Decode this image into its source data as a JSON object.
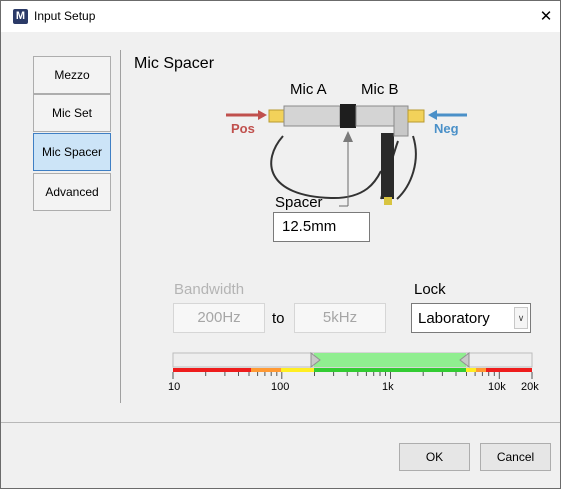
{
  "window": {
    "app_icon_letter": "M",
    "title": "Input Setup",
    "close_glyph": "✕"
  },
  "nav": {
    "items": [
      {
        "label": "Mezzo",
        "active": false
      },
      {
        "label": "Mic Set",
        "active": false
      },
      {
        "label": "Mic Spacer",
        "active": true
      },
      {
        "label": "Advanced",
        "active": false
      }
    ]
  },
  "panel": {
    "title": "Mic Spacer",
    "diagram": {
      "mic_a_label": "Mic A",
      "mic_b_label": "Mic B",
      "pos_label": "Pos",
      "neg_label": "Neg",
      "pos_color": "#c0504d",
      "neg_color": "#4a90c8"
    },
    "spacer": {
      "label": "Spacer",
      "value": "12.5mm"
    },
    "bandwidth": {
      "label": "Bandwidth",
      "from": "200Hz",
      "to_word": "to",
      "to": "5kHz"
    },
    "lock": {
      "label": "Lock",
      "value": "Laboratory"
    },
    "freq_axis": {
      "tick_labels": [
        "10",
        "100",
        "1k",
        "10k",
        "20k"
      ],
      "range_hz": [
        10,
        20000
      ],
      "selected_hz": [
        200,
        5000
      ],
      "range_color": "#90ee90"
    }
  },
  "footer": {
    "ok_label": "OK",
    "cancel_label": "Cancel"
  }
}
